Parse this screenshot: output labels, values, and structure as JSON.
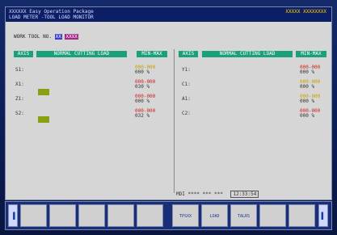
{
  "titlebar": {
    "title": "XXXXXX Easy Operation Package",
    "subtitle": "LOAD METER -TOOL LOAD MONITOR",
    "code": "XXXXX XXXXXXXX"
  },
  "tool": {
    "label": "WORK TOOL NO.",
    "value1": "XX",
    "value2": "XXXX"
  },
  "left_headers": {
    "axis": "AXIS",
    "load": "NORMAL CUTTING LOAD",
    "minmax": "MIN-MAX"
  },
  "right_headers": {
    "axis": "AXIS",
    "load": "NORMAL CUTTING LOAD",
    "minmax": "MIN-MAX"
  },
  "left_rows": [
    {
      "axis": "S1:",
      "range": "000-000",
      "pct": "000 %"
    },
    {
      "axis": "X1:",
      "range": "000-000",
      "pct": "030 %"
    },
    {
      "axis": "Z1:",
      "range": "000-000",
      "pct": "000 %"
    },
    {
      "axis": "S2:",
      "range": "000-000",
      "pct": "032 %"
    }
  ],
  "right_rows": [
    {
      "axis": "Y1:",
      "range": "000-000",
      "pct": "000 %"
    },
    {
      "axis": "C1:",
      "range": "000-000",
      "pct": "000 %"
    },
    {
      "axis": "A1:",
      "range": "000-000",
      "pct": "000 %"
    },
    {
      "axis": "C2:",
      "range": "000-000",
      "pct": "000 %"
    }
  ],
  "status": {
    "mode": "MDI",
    "info": "**** *** ***",
    "time": "12:33:54"
  },
  "softkeys": [
    {
      "label": "",
      "type": "nav-left"
    },
    {
      "label": ""
    },
    {
      "label": ""
    },
    {
      "label": ""
    },
    {
      "label": ""
    },
    {
      "label": ""
    },
    {
      "label": "TPSXX"
    },
    {
      "label": "LOAD"
    },
    {
      "label": "TALRS"
    },
    {
      "label": ""
    },
    {
      "label": ""
    },
    {
      "label": "",
      "type": "nav-right"
    }
  ],
  "colors": {
    "titlebar": "#0c1e66",
    "header": "#1aa07a",
    "bar": "#8aa010",
    "value_yellow": "#c8a000",
    "value_red": "#d02020"
  }
}
